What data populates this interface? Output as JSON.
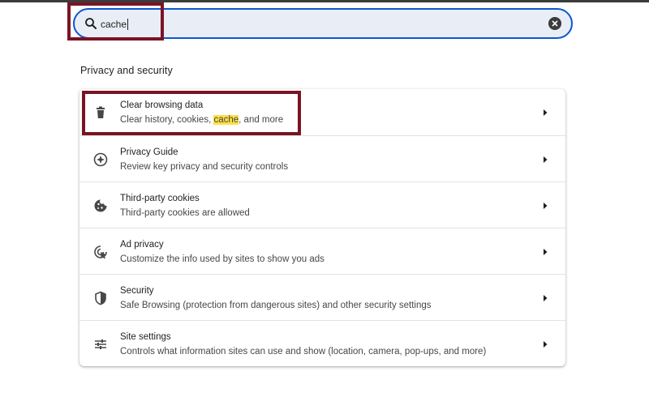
{
  "search": {
    "value": "cache",
    "icon": "search-icon",
    "clear_icon": "clear-search-icon"
  },
  "section": {
    "title": "Privacy and security"
  },
  "rows": [
    {
      "title": "Clear browsing data",
      "sub_before": "Clear history, cookies, ",
      "sub_highlight": "cache",
      "sub_after": ", and more",
      "icon": "trash-icon"
    },
    {
      "title": "Privacy Guide",
      "sub": "Review key privacy and security controls",
      "icon": "privacy-guide-icon"
    },
    {
      "title": "Third-party cookies",
      "sub": "Third-party cookies are allowed",
      "icon": "cookie-icon"
    },
    {
      "title": "Ad privacy",
      "sub": "Customize the info used by sites to show you ads",
      "icon": "ad-privacy-icon"
    },
    {
      "title": "Security",
      "sub": "Safe Browsing (protection from dangerous sites) and other security settings",
      "icon": "shield-icon"
    },
    {
      "title": "Site settings",
      "sub": "Controls what information sites can use and show (location, camera, pop-ups, and more)",
      "icon": "sliders-icon"
    }
  ],
  "colors": {
    "accent": "#0b57d0",
    "search_bg": "#e9eef6",
    "highlight_box": "#7a1424",
    "match_highlight": "#fde047"
  }
}
